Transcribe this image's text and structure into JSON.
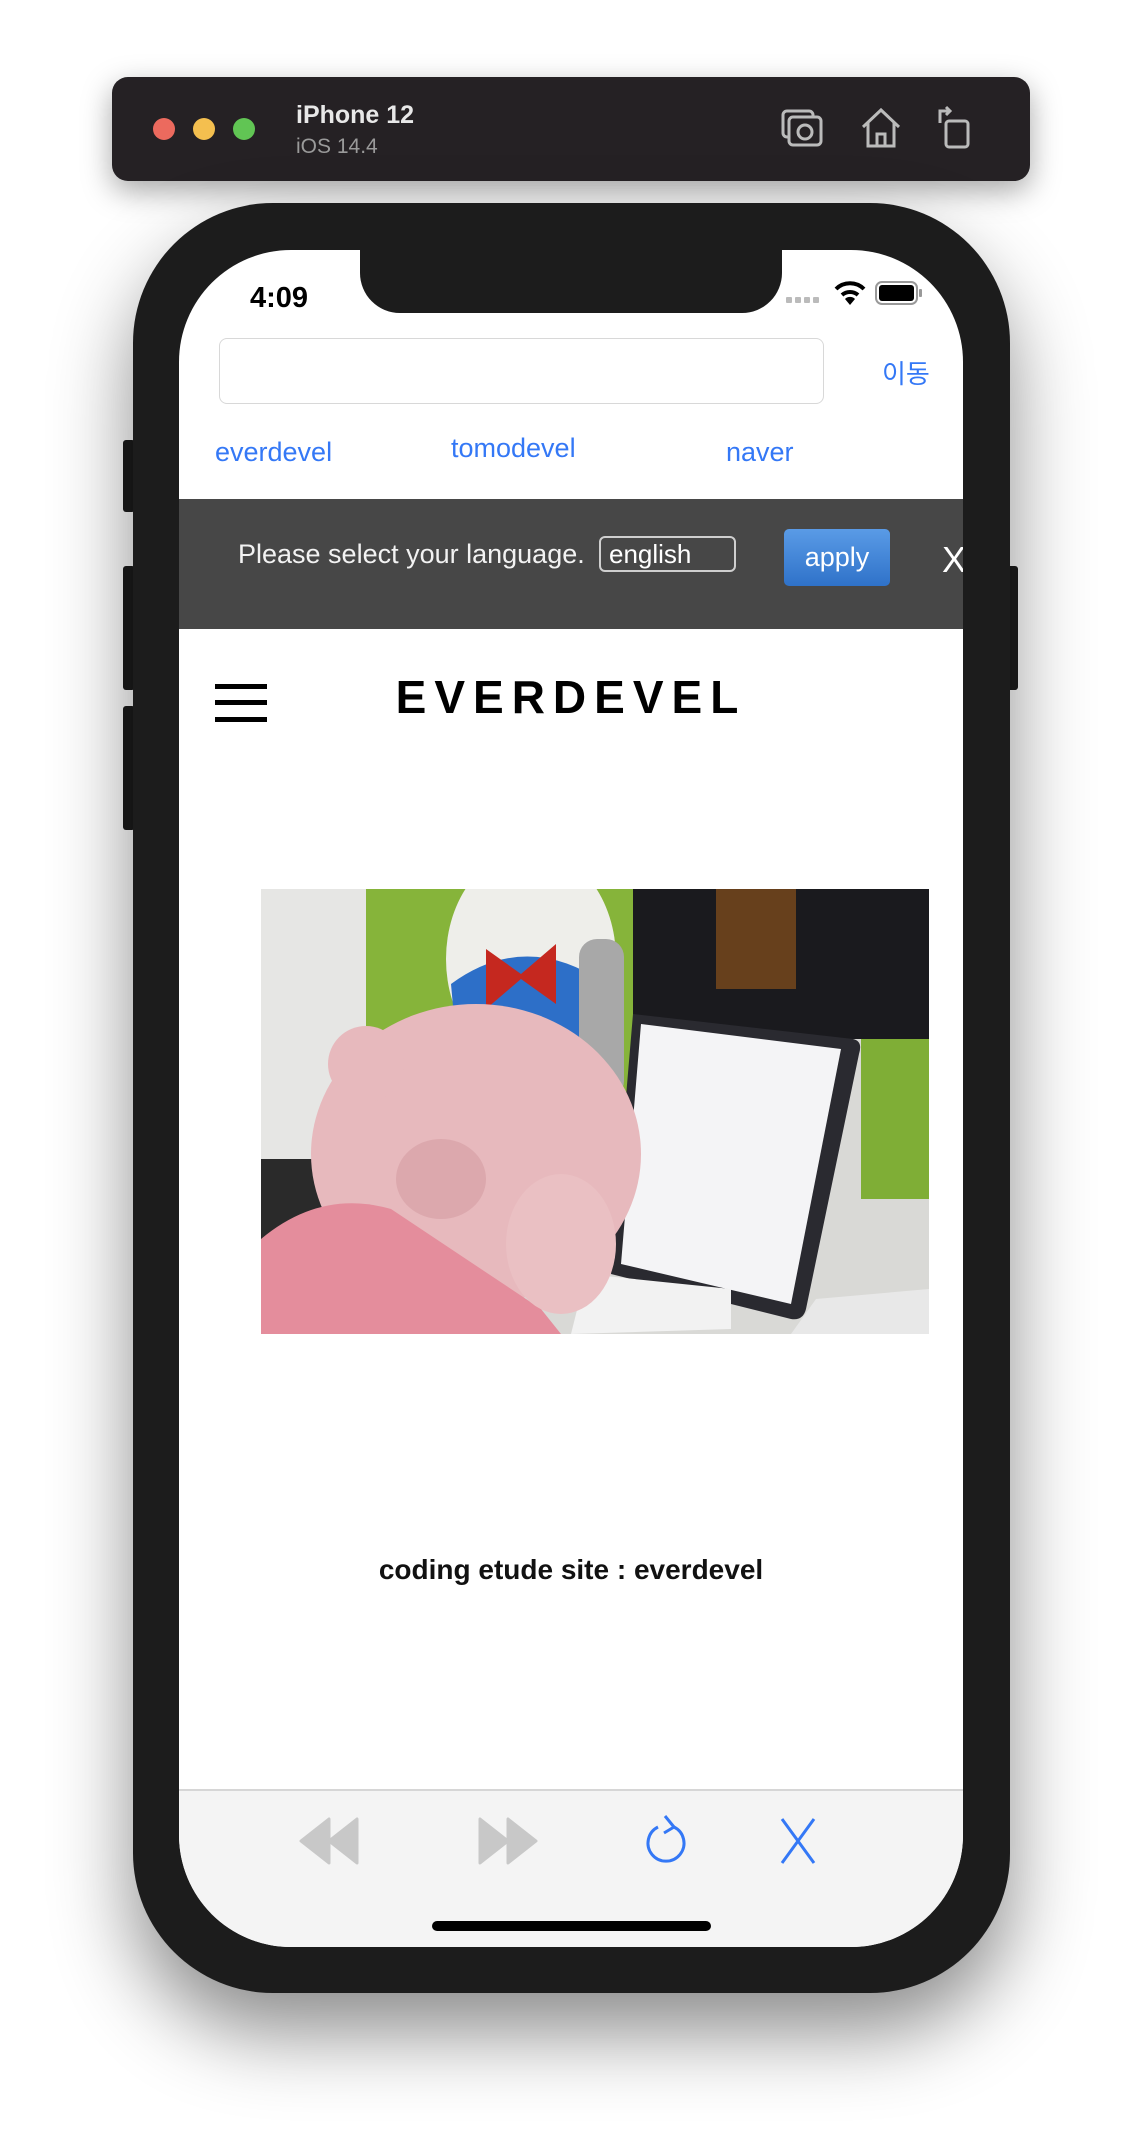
{
  "simulator": {
    "device": "iPhone 12",
    "os": "iOS 14.4",
    "icons": [
      "screenshot-icon",
      "home-icon",
      "rotate-icon"
    ]
  },
  "status_bar": {
    "time": "4:09",
    "icons": [
      "signal-icon",
      "wifi-icon",
      "battery-icon"
    ]
  },
  "browser": {
    "url_value": "",
    "url_placeholder": "",
    "go_label": "이동",
    "quick_links": [
      "everdevel",
      "tomodevel",
      "naver"
    ]
  },
  "language_bar": {
    "prompt": "Please select your language.",
    "selected": "english",
    "apply_label": "apply",
    "close_label": "X"
  },
  "site": {
    "logo": "EVERDEVEL",
    "caption": "coding etude site : everdevel"
  },
  "toolbar": {
    "icons": [
      "back-icon",
      "forward-icon",
      "reload-icon",
      "close-icon"
    ]
  },
  "colors": {
    "accent": "#3478f6",
    "language_bar": "#474747",
    "apply_button": "#3a80d6",
    "toolbar": "#f4f4f4",
    "disabled_icon": "#c8c8c8"
  }
}
